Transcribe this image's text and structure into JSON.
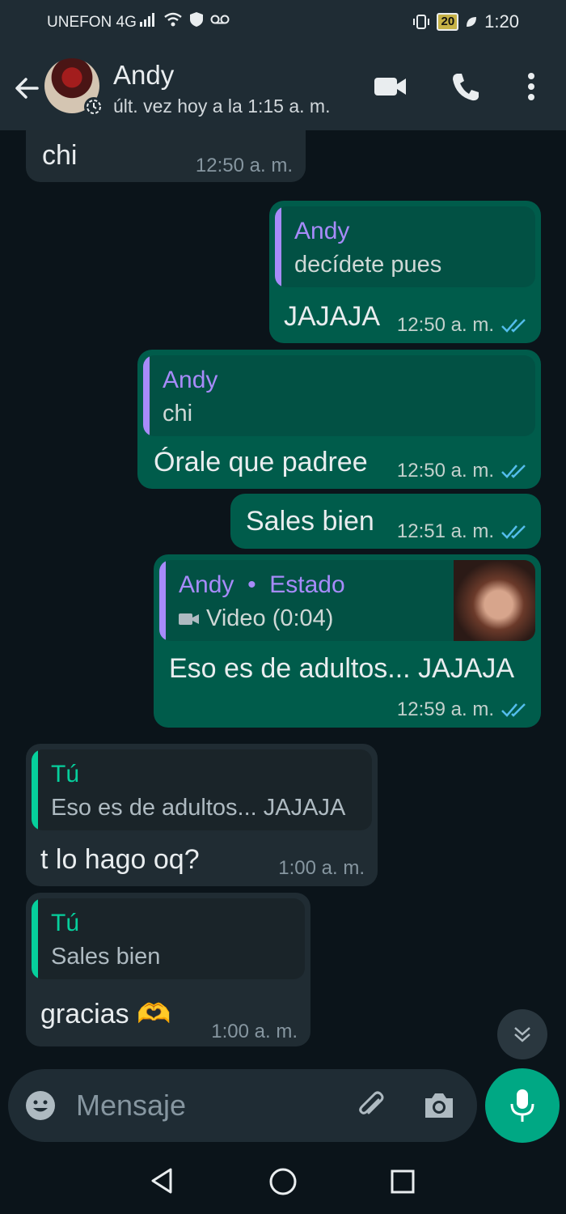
{
  "status_bar": {
    "carrier": "UNEFON 4G",
    "battery": "20",
    "time": "1:20"
  },
  "header": {
    "name": "Andy",
    "last_seen": "últ. vez hoy a la 1:15 a. m."
  },
  "messages": [
    {
      "text": "chi",
      "time": "12:50 a. m."
    },
    {
      "quote_name": "Andy",
      "quote_text": "decídete pues",
      "text": "JAJAJA",
      "time": "12:50 a. m."
    },
    {
      "quote_name": "Andy",
      "quote_text": "chi",
      "text": "Órale que padree",
      "time": "12:50 a. m."
    },
    {
      "text": "Sales bien",
      "time": "12:51 a. m."
    },
    {
      "quote_name": "Andy",
      "quote_separator": "•",
      "quote_source": "Estado",
      "quote_text": "Video (0:04)",
      "text": "Eso es de adultos... JAJAJA",
      "time": "12:59 a. m."
    },
    {
      "quote_name": "Tú",
      "quote_text": "Eso es de adultos... JAJAJA",
      "text": "t lo hago oq?",
      "time": "1:00 a. m."
    },
    {
      "quote_name": "Tú",
      "quote_text": "Sales bien",
      "text": "gracias 🫶",
      "time": "1:00 a. m."
    }
  ],
  "composer": {
    "placeholder": "Mensaje"
  },
  "colors": {
    "accent": "#00a884",
    "out_bubble": "#005c4b",
    "in_bubble": "#202c33",
    "quote_purple": "#a78bfa",
    "quote_green": "#06cf9c",
    "read_ticks": "#53bdeb"
  },
  "icons": [
    "back-arrow-icon",
    "video-call-icon",
    "phone-icon",
    "more-options-icon",
    "chevron-double-down-icon",
    "emoji-icon",
    "attach-icon",
    "camera-icon",
    "mic-icon",
    "nav-back-icon",
    "nav-home-icon",
    "nav-recents-icon"
  ]
}
